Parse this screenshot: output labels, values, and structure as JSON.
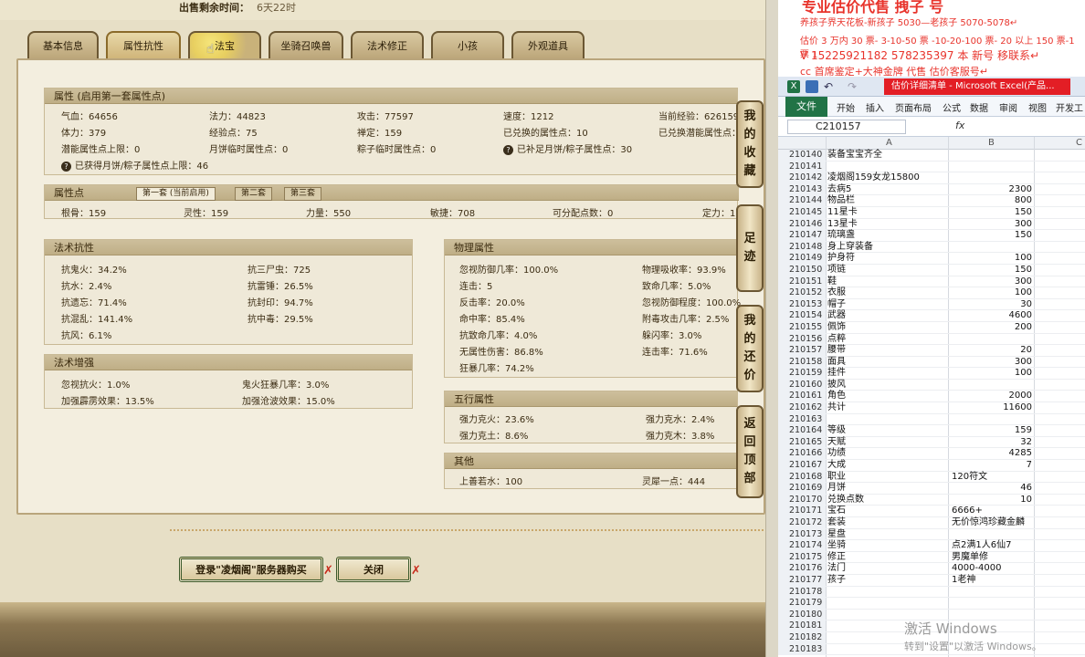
{
  "header": {
    "sell_time_label": "出售剩余时间：",
    "sell_time_value": "6天22时"
  },
  "tabs": [
    "基本信息",
    "属性抗性",
    "法宝",
    "坐骑召唤兽",
    "法术修正",
    "小孩",
    "外观道具"
  ],
  "attributes": {
    "title": "属性 (启用第一套属性点)",
    "rows": [
      [
        "气血：64656",
        "法力：44823",
        "攻击：77597",
        "速度：1212",
        "当前经验：626159"
      ],
      [
        "体力：379",
        "经验点：75",
        "禅定：159",
        "已兑换的属性点：10",
        "已兑换潜能属性点：1"
      ],
      [
        "潜能属性点上限：0",
        "月饼临时属性点：0",
        "粽子临时属性点：0",
        "已补足月饼/粽子属性点：30",
        ""
      ]
    ],
    "note": "已获得月饼/粽子属性点上限：46"
  },
  "points": {
    "title": "属性点",
    "subtabs": [
      "第一套 (当前启用)",
      "第二套",
      "第三套"
    ],
    "values": [
      "根骨：159",
      "灵性：159",
      "力量：550",
      "敏捷：708",
      "可分配点数：0",
      "定力：1"
    ]
  },
  "magic_resist": {
    "title": "法术抗性",
    "rows": [
      [
        "抗鬼火：34.2%",
        "抗三尸虫：725"
      ],
      [
        "抗水：2.4%",
        "抗雷锤：26.5%"
      ],
      [
        "抗遗忘：71.4%",
        "抗封印：94.7%"
      ],
      [
        "抗混乱：141.4%",
        "抗中毒：29.5%"
      ],
      [
        "抗风：6.1%",
        ""
      ]
    ]
  },
  "magic_boost": {
    "title": "法术增强",
    "rows": [
      [
        "忽视抗火：1.0%",
        "鬼火狂暴几率：3.0%"
      ],
      [
        "加强霹雳效果：13.5%",
        "加强沧波效果：15.0%"
      ]
    ]
  },
  "physical": {
    "title": "物理属性",
    "rows": [
      [
        "忽视防御几率：100.0%",
        "物理吸收率：93.9%"
      ],
      [
        "连击：5",
        "致命几率：5.0%"
      ],
      [
        "反击率：20.0%",
        "忽视防御程度：100.0%"
      ],
      [
        "命中率：85.4%",
        "附毒攻击几率：2.5%"
      ],
      [
        "抗致命几率：4.0%",
        "躲闪率：3.0%"
      ],
      [
        "无属性伤害：86.8%",
        "连击率：71.6%"
      ],
      [
        "狂暴几率：74.2%",
        ""
      ]
    ]
  },
  "five_elements": {
    "title": "五行属性",
    "rows": [
      [
        "强力克火：23.6%",
        "强力克水：2.4%"
      ],
      [
        "强力克土：8.6%",
        "强力克木：3.8%"
      ]
    ]
  },
  "other": {
    "title": "其他",
    "rows": [
      [
        "上善若水：100",
        "灵犀一点：444"
      ]
    ]
  },
  "side_buttons": [
    [
      "我",
      "的",
      "收",
      "藏"
    ],
    [
      "足",
      "迹"
    ],
    [
      "我",
      "的",
      "还",
      "价"
    ],
    [
      "返",
      "回",
      "顶",
      "部"
    ]
  ],
  "buttons": {
    "buy": "登录\"凌烟阁\"服务器购买",
    "close": "关闭"
  },
  "promo": {
    "line1": "专业估价代售 拽子 号",
    "line2": "养孩子界天花板-新孩子 5030—老孩子 5070-5078↵",
    "line3": "估价 3 万内 30 票- 3-10-50 票 -10-20-100 票- 20 以上 150 票-1 票 1",
    "line4": "V 15225921182        578235397 本 新号 移联系↵",
    "line5": "cc 首席鉴定+大神金牌 代售 估价客服号↵"
  },
  "excel": {
    "window_title": "估价详细清单 - Microsoft Excel(产品...",
    "ribbon_tabs": [
      "文件",
      "开始",
      "插入",
      "页面布局",
      "公式",
      "数据",
      "审阅",
      "视图",
      "开发工"
    ],
    "name_box": "C210157",
    "fx": "fx",
    "columns": [
      "A",
      "B",
      "C"
    ],
    "rows": [
      [
        "210140",
        "装备宝宝齐全",
        ""
      ],
      [
        "210141",
        "",
        ""
      ],
      [
        "210142",
        "凌烟阁159女龙15800",
        ""
      ],
      [
        "210143",
        "去病5",
        "2300"
      ],
      [
        "210144",
        "物品栏",
        "800"
      ],
      [
        "210145",
        "11星卡",
        "150"
      ],
      [
        "210146",
        "13星卡",
        "300"
      ],
      [
        "210147",
        "琉璃盏",
        "150"
      ],
      [
        "210148",
        "身上穿装备",
        ""
      ],
      [
        "210149",
        "护身符",
        "100"
      ],
      [
        "210150",
        "项链",
        "150"
      ],
      [
        "210151",
        "鞋",
        "300"
      ],
      [
        "210152",
        "衣服",
        "100"
      ],
      [
        "210153",
        "帽子",
        "30"
      ],
      [
        "210154",
        "武器",
        "4600"
      ],
      [
        "210155",
        "佩饰",
        "200"
      ],
      [
        "210156",
        "点粹",
        ""
      ],
      [
        "210157",
        "腰带",
        "20"
      ],
      [
        "210158",
        "面具",
        "300"
      ],
      [
        "210159",
        "挂件",
        "100"
      ],
      [
        "210160",
        "披风",
        ""
      ],
      [
        "210161",
        "角色",
        "2000"
      ],
      [
        "210162",
        "共计",
        "11600"
      ],
      [
        "210163",
        "",
        ""
      ],
      [
        "210164",
        "等级",
        "159"
      ],
      [
        "210165",
        "天赋",
        "32"
      ],
      [
        "210166",
        "功绩",
        "4285"
      ],
      [
        "210167",
        "大成",
        "7"
      ],
      [
        "210168",
        "职业",
        "120符文"
      ],
      [
        "210169",
        "月饼",
        "46"
      ],
      [
        "210170",
        "兑换点数",
        "10"
      ],
      [
        "210171",
        "宝石",
        "6666+"
      ],
      [
        "210172",
        "套装",
        "无价惊鸿珍藏金麟"
      ],
      [
        "210173",
        "星盘",
        ""
      ],
      [
        "210174",
        "坐骑",
        "点2满1人6仙7"
      ],
      [
        "210175",
        "修正",
        "男魔单修"
      ],
      [
        "210176",
        "法门",
        "4000-4000"
      ],
      [
        "210177",
        "孩子",
        "1老神"
      ],
      [
        "210178",
        "",
        ""
      ],
      [
        "210179",
        "",
        ""
      ],
      [
        "210180",
        "",
        ""
      ],
      [
        "210181",
        "",
        ""
      ],
      [
        "210182",
        "",
        ""
      ],
      [
        "210183",
        "",
        ""
      ]
    ],
    "watermark1": "激活 Windows",
    "watermark2": "转到\"设置\"以激活 Windows。"
  }
}
